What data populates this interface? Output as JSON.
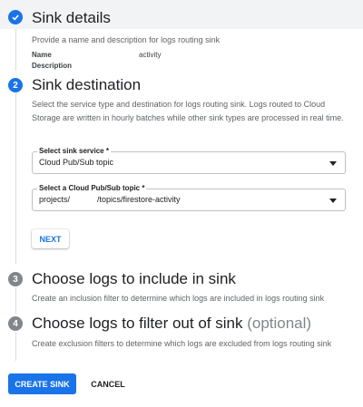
{
  "steps": [
    {
      "number": "1",
      "state": "done",
      "title": "Sink details",
      "description": "Provide a name and description for logs routing sink",
      "fields": [
        {
          "label": "Name",
          "value": "activity"
        },
        {
          "label": "Description",
          "value": ""
        }
      ]
    },
    {
      "number": "2",
      "state": "active",
      "title": "Sink destination",
      "description": "Select the service type and destination for logs routing sink. Logs routed to Cloud Storage are written in hourly batches while other sink types are processed in real time.",
      "sink_service": {
        "label": "Select sink service *",
        "value": "Cloud Pub/Sub topic"
      },
      "pubsub_topic": {
        "label": "Select a Cloud Pub/Sub topic *",
        "value": "projects/            /topics/firestore-activity"
      },
      "next_label": "NEXT"
    },
    {
      "number": "3",
      "state": "idle",
      "title": "Choose logs to include in sink",
      "description": "Create an inclusion filter to determine which logs are included in logs routing sink"
    },
    {
      "number": "4",
      "state": "idle",
      "title": "Choose logs to filter out of sink",
      "title_optional": "(optional)",
      "description": "Create exclusion filters to determine which logs are excluded from logs routing sink"
    }
  ],
  "actions": {
    "create_label": "CREATE SINK",
    "cancel_label": "CANCEL"
  },
  "colors": {
    "accent": "#1a73e8",
    "idle_step": "#80868b",
    "header_background": "#f1f3f4"
  }
}
